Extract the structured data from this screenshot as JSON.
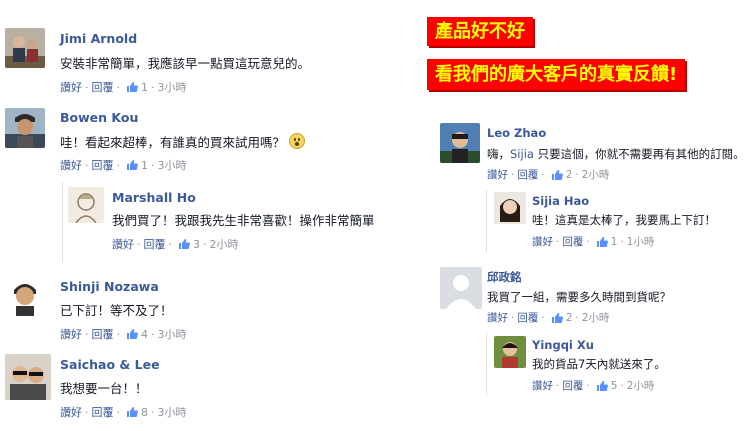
{
  "banner": {
    "line1": "產品好不好",
    "line2": "看我們的廣大客戶的真實反饋!"
  },
  "actions": {
    "like": "讚好",
    "reply": "回覆",
    "sep": "·"
  },
  "comments": [
    {
      "name": "Jimi Arnold",
      "text": "安裝非常簡單，我應該早一點買這玩意兒的。",
      "likes": "1",
      "time": "3小時"
    },
    {
      "name": "Bowen Kou",
      "text": "哇！看起來超棒，有誰真的買來試用嗎？",
      "likes": "1",
      "time": "3小時"
    },
    {
      "name": "Marshall Ho",
      "text": "我們買了！我跟我先生非常喜歡！操作非常簡單",
      "likes": "3",
      "time": "2小時"
    },
    {
      "name": "Shinji Nozawa",
      "text": "已下訂！等不及了！",
      "likes": "4",
      "time": "3小時"
    },
    {
      "name": "Saichao & Lee",
      "text": "我想要一台！！",
      "likes": "8",
      "time": "3小時"
    },
    {
      "name": "Leo Zhao",
      "text_pre": "嗨，",
      "mention": "Sijia",
      "text_post": " 只要這個，你就不需要再有其他的訂閱。",
      "likes": "2",
      "time": "2小時"
    },
    {
      "name": "Sijia Hao",
      "text": "哇！這真是太棒了，我要馬上下訂！",
      "likes": "1",
      "time": "1小時"
    },
    {
      "name": "邱政銘",
      "text": "我買了一組，需要多久時間到貨呢？",
      "likes": "2",
      "time": "2小時"
    },
    {
      "name": "Yingqi Xu",
      "text": "我的貨品7天內就送來了。",
      "likes": "5",
      "time": "2小時"
    }
  ],
  "colors": {
    "name": "#3b5998",
    "meta": "#90949c",
    "banner_bg": "#ff0000",
    "banner_text": "#ffff00"
  }
}
